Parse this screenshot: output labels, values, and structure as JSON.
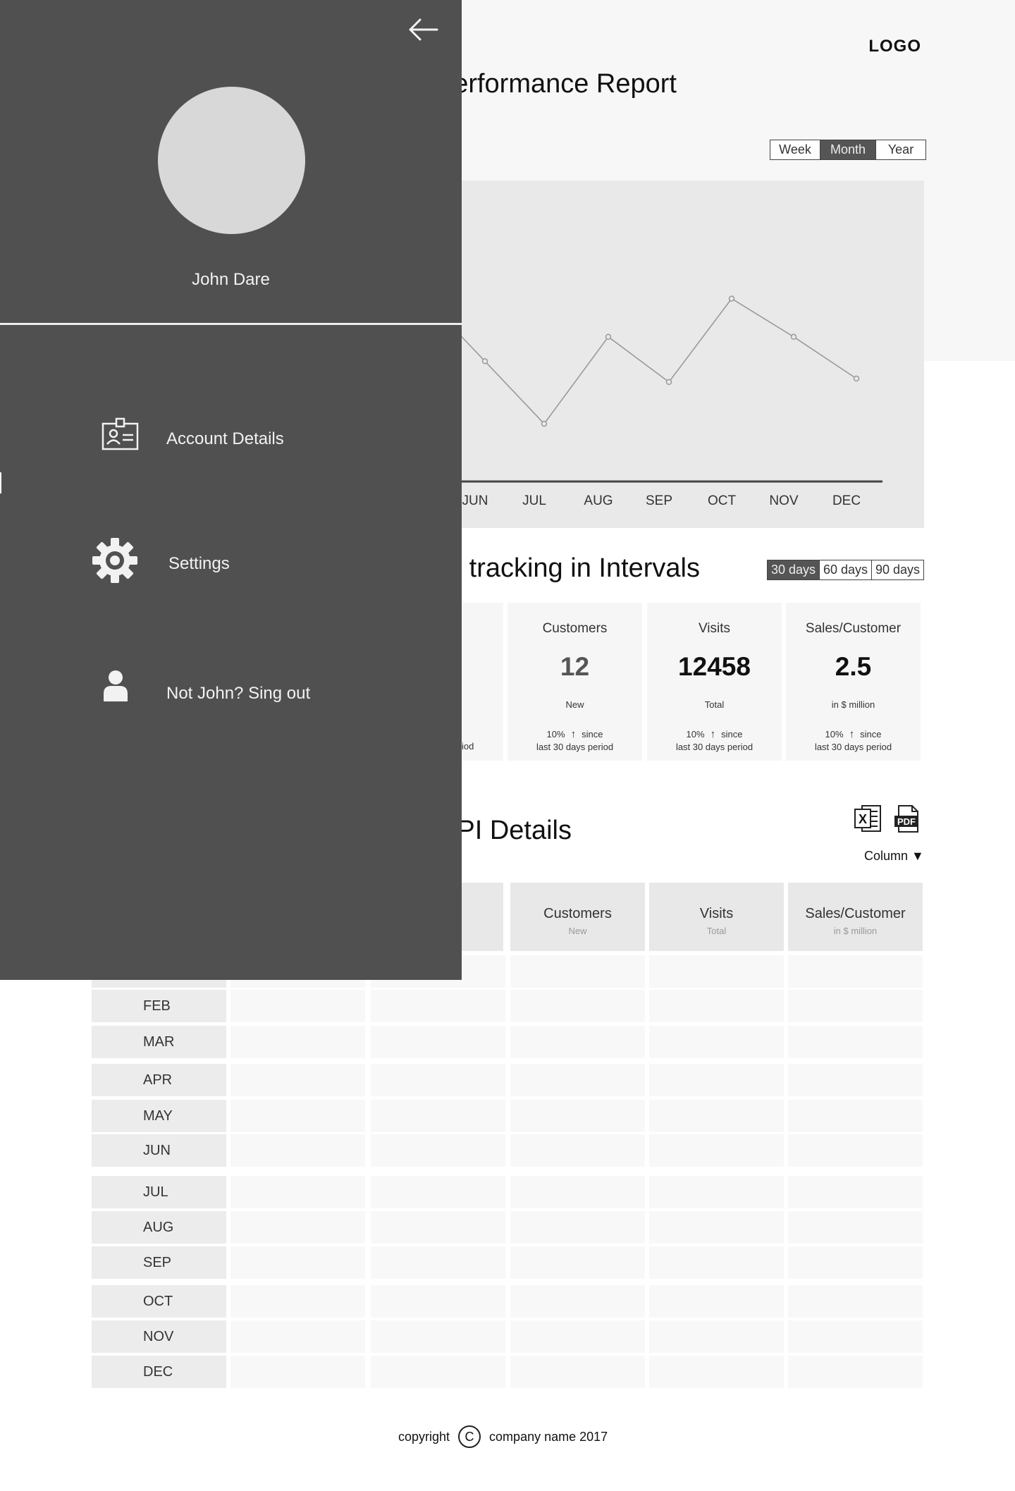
{
  "header": {
    "logo": "LOGO",
    "report_title": "Performance Report",
    "tracking_title": "Performance tracking in Intervals",
    "kpi_title": "KPI Details"
  },
  "period_selector": {
    "options": [
      "Week",
      "Month",
      "Year"
    ],
    "active": "Month"
  },
  "interval_selector": {
    "options": [
      "30 days",
      "60 days",
      "90 days"
    ],
    "active": "30 days"
  },
  "chart_data": {
    "type": "line",
    "categories": [
      "JUN",
      "JUL",
      "AUG",
      "SEP",
      "OCT",
      "NOV",
      "DEC"
    ],
    "values": [
      48,
      30,
      55,
      42,
      66,
      55,
      43
    ],
    "ylim": [
      0,
      100
    ],
    "grid": false
  },
  "kpi_cards": [
    {
      "label": "Customers",
      "value": "12",
      "sub": "New",
      "change": "10%",
      "since": "since",
      "period": "last 30 days period"
    },
    {
      "label": "Visits",
      "value": "12458",
      "sub": "Total",
      "change": "10%",
      "since": "since",
      "period": "last 30 days period"
    },
    {
      "label": "Sales/Customer",
      "value": "2.5",
      "sub": "in $ million",
      "change": "10%",
      "since": "since",
      "period": "last 30 days period"
    }
  ],
  "kpi_partial": {
    "sub_fragment": "l",
    "since_fragment": "e",
    "period_fragment": "iod"
  },
  "export": {
    "column_label": "Column",
    "excel_icon": "excel-icon",
    "pdf_icon": "pdf-icon"
  },
  "table": {
    "headers": [
      {
        "main": "Customers",
        "sub": "New"
      },
      {
        "main": "Visits",
        "sub": "Total"
      },
      {
        "main": "Sales/Customer",
        "sub": "in $ million"
      }
    ],
    "rows": [
      "FEB",
      "MAR",
      "APR",
      "MAY",
      "JUN",
      "JUL",
      "AUG",
      "SEP",
      "OCT",
      "NOV",
      "DEC"
    ]
  },
  "footer": {
    "copyright": "copyright",
    "symbol": "C",
    "company": "company name 2017"
  },
  "drawer": {
    "user_name": "John Dare",
    "menu": [
      {
        "label": "Account Details",
        "icon": "id-card-icon"
      },
      {
        "label": "Settings",
        "icon": "gear-icon"
      },
      {
        "label": "Not John? Sing out",
        "icon": "user-icon"
      }
    ]
  },
  "colors": {
    "drawer_bg": "#505050",
    "chart_bg": "#e9e9e9",
    "line": "#9a9a9a",
    "active_segment": "#555555"
  }
}
